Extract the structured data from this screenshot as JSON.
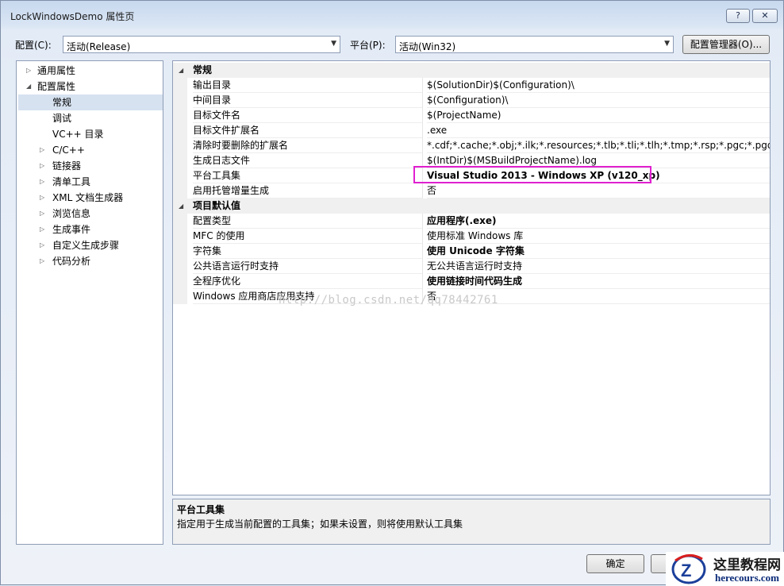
{
  "window": {
    "title": "LockWindowsDemo 属性页",
    "help": "?",
    "close": "✕"
  },
  "toolbar": {
    "config_label": "配置(C):",
    "config_value": "活动(Release)",
    "platform_label": "平台(P):",
    "platform_value": "活动(Win32)",
    "config_manager": "配置管理器(O)..."
  },
  "tree": [
    {
      "label": "通用属性",
      "twisty": "▷",
      "expanded": false
    },
    {
      "label": "配置属性",
      "twisty": "◢",
      "expanded": true
    },
    {
      "label": "常规",
      "twisty": "",
      "selected": true
    },
    {
      "label": "调试",
      "twisty": ""
    },
    {
      "label": "VC++ 目录",
      "twisty": ""
    },
    {
      "label": "C/C++",
      "twisty": "▷"
    },
    {
      "label": "链接器",
      "twisty": "▷"
    },
    {
      "label": "清单工具",
      "twisty": "▷"
    },
    {
      "label": "XML 文档生成器",
      "twisty": "▷"
    },
    {
      "label": "浏览信息",
      "twisty": "▷"
    },
    {
      "label": "生成事件",
      "twisty": "▷"
    },
    {
      "label": "自定义生成步骤",
      "twisty": "▷"
    },
    {
      "label": "代码分析",
      "twisty": "▷"
    }
  ],
  "grid": {
    "categories": [
      {
        "name": "常规",
        "twisty": "◢",
        "rows": [
          {
            "name": "输出目录",
            "value": "$(SolutionDir)$(Configuration)\\",
            "bold": false
          },
          {
            "name": "中间目录",
            "value": "$(Configuration)\\",
            "bold": false
          },
          {
            "name": "目标文件名",
            "value": "$(ProjectName)",
            "bold": false
          },
          {
            "name": "目标文件扩展名",
            "value": ".exe",
            "bold": false
          },
          {
            "name": "清除时要删除的扩展名",
            "value": "*.cdf;*.cache;*.obj;*.ilk;*.resources;*.tlb;*.tli;*.tlh;*.tmp;*.rsp;*.pgc;*.pgd;*.meta",
            "bold": false
          },
          {
            "name": "生成日志文件",
            "value": "$(IntDir)$(MSBuildProjectName).log",
            "bold": false
          },
          {
            "name": "平台工具集",
            "value": "Visual Studio 2013 - Windows XP (v120_xp)",
            "bold": true
          },
          {
            "name": "启用托管增量生成",
            "value": "否",
            "bold": false
          }
        ]
      },
      {
        "name": "项目默认值",
        "twisty": "◢",
        "rows": [
          {
            "name": "配置类型",
            "value": "应用程序(.exe)",
            "bold": true
          },
          {
            "name": "MFC 的使用",
            "value": "使用标准 Windows 库",
            "bold": false
          },
          {
            "name": "字符集",
            "value": "使用 Unicode 字符集",
            "bold": true
          },
          {
            "name": "公共语言运行时支持",
            "value": "无公共语言运行时支持",
            "bold": false
          },
          {
            "name": "全程序优化",
            "value": "使用链接时间代码生成",
            "bold": true
          },
          {
            "name": "Windows 应用商店应用支持",
            "value": "否",
            "bold": false
          }
        ]
      }
    ]
  },
  "description": {
    "title": "平台工具集",
    "text": "指定用于生成当前配置的工具集；如果未设置，则将使用默认工具集"
  },
  "buttons": {
    "ok": "确定"
  },
  "watermark": "http://blog.csdn.net/qq78442761",
  "logo": {
    "line1": "这里教程网",
    "line2": "herecours.com"
  },
  "colors": {
    "highlight_border": "#e020d0",
    "selection": "#d6e2f0"
  }
}
